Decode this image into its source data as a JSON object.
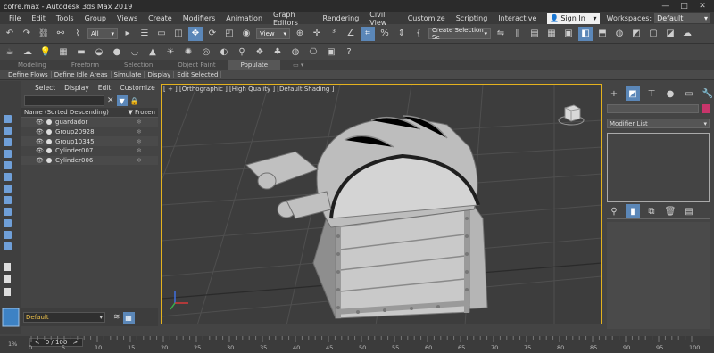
{
  "titlebar": {
    "title": "cofre.max - Autodesk 3ds Max 2019",
    "minimize": "—",
    "maximize": "□",
    "close": "✕"
  },
  "menu": {
    "items": [
      "File",
      "Edit",
      "Tools",
      "Group",
      "Views",
      "Create",
      "Modifiers",
      "Animation",
      "Graph Editors",
      "Rendering",
      "Civil View",
      "Customize",
      "Scripting",
      "Interactive"
    ],
    "sign_in": "Sign In",
    "workspaces_label": "Workspaces:",
    "workspaces_value": "Default"
  },
  "toolbar": {
    "selection_filter": "All",
    "view_dropdown": "View",
    "create_selection_set": "Create Selection Se"
  },
  "ribbon": {
    "tabs": [
      "Modeling",
      "Freeform",
      "Selection",
      "Object Paint",
      "Populate"
    ],
    "active_tab": "Populate",
    "buttons": [
      "Define Flows",
      "Define Idle Areas",
      "Simulate",
      "Display",
      "Edit Selected"
    ]
  },
  "scene_explorer": {
    "tabs": [
      "Select",
      "Display",
      "Edit",
      "Customize"
    ],
    "column_name": "Name (Sorted Descending)",
    "column_frozen": "▼ Frozen",
    "items": [
      "guardador",
      "Group20928",
      "Group10345",
      "Cylinder007",
      "Cylinder006"
    ]
  },
  "layer": {
    "current": "Default"
  },
  "viewport": {
    "label": "[ + ] [Orthographic ] [High Quality ] [Default Shading ]"
  },
  "command_panel": {
    "modifier_list": "Modifier List",
    "object_color": "#c8356b"
  },
  "timeline": {
    "frame_display": "0 / 100",
    "percent": "1%",
    "ticks": [
      "0",
      "5",
      "10",
      "15",
      "20",
      "25",
      "30",
      "35",
      "40",
      "45",
      "50",
      "55",
      "60",
      "65",
      "70",
      "75",
      "80",
      "85",
      "90",
      "95",
      "100"
    ]
  },
  "colors": {
    "accent": "#5b87b8",
    "viewport_border": "#e4b21e",
    "layer_text": "#f3c54b"
  }
}
